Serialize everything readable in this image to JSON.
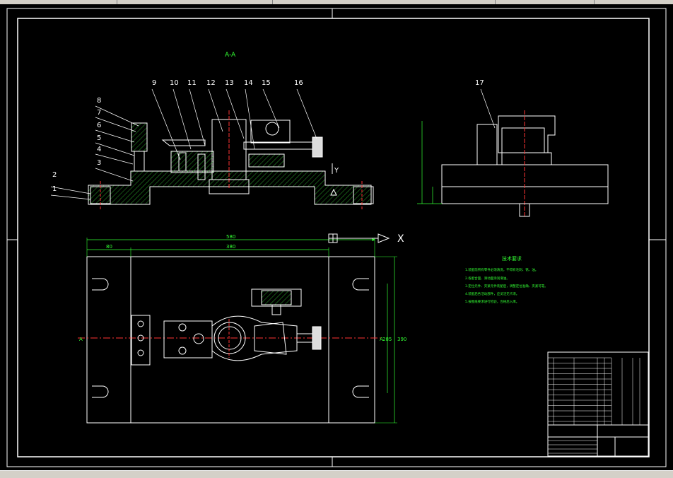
{
  "window": {
    "title": ""
  },
  "drawing": {
    "section_label": "A-A",
    "part_numbers": [
      "1",
      "2",
      "3",
      "4",
      "5",
      "6",
      "7",
      "8",
      "9",
      "10",
      "11",
      "12",
      "13",
      "14",
      "15",
      "16",
      "17"
    ],
    "axis_x": "X",
    "axis_y": "Y",
    "section_mark": "A",
    "dims": {
      "overall_width": "580",
      "left_offset": "80",
      "inner_width": "380",
      "height_outer": "390",
      "height_inner": "285"
    },
    "tech_req_title": "技术要求",
    "tech_req_lines": [
      "1.装配前所有零件必须清洗，不得有毛刺、锈、油。",
      "2.各配合面、滑动面涂润滑油。",
      "3.定位元件、夹紧元件装配后，调整定位准确、夹紧可靠。",
      "4.装配后各活动部件，应灵活无卡滞。",
      "5.按图纸要求进行检验，合格后入库。"
    ],
    "colors": {
      "line": "#ffffff",
      "dim": "#33ff33",
      "center": "#ff3333",
      "hatch": "#33cc33",
      "bg": "#000000"
    }
  }
}
